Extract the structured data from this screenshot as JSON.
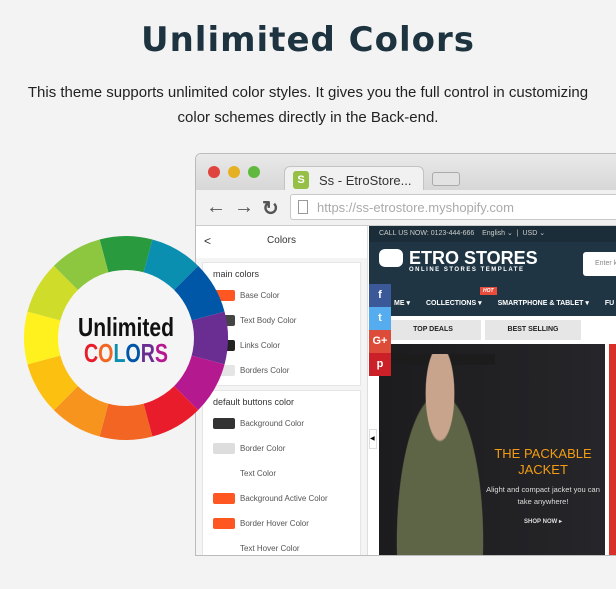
{
  "title": "Unlimited Colors",
  "description": "This theme supports unlimited color styles. It gives you the full control in customizing color schemes directly in the Back-end.",
  "badge": {
    "line1": "Unlimited",
    "line2": [
      "C",
      "O",
      "L",
      "O",
      "R",
      "S"
    ],
    "line2_colors": [
      "#e81c2a",
      "#f26522",
      "#0a8fb0",
      "#0057a8",
      "#6a2d91",
      "#b5198f"
    ],
    "wheel_colors": [
      "#2a9a3e",
      "#0a8fb0",
      "#0057a8",
      "#6a2d91",
      "#b5198f",
      "#e81c2a",
      "#f26522",
      "#f7941d",
      "#fcc010",
      "#fff11e",
      "#cfdc2a",
      "#8dc63f"
    ]
  },
  "browser": {
    "tab": "Ss - EtroStore...",
    "url": "https://ss-etrostore.myshopify.com"
  },
  "sidebar": {
    "back": "<",
    "title": "Colors",
    "main": {
      "heading": "main colors",
      "items": [
        {
          "label": "Base Color",
          "color": "#ff5722"
        },
        {
          "label": "Text Body Color",
          "color": "#444444"
        },
        {
          "label": "Links Color",
          "color": "#222222"
        },
        {
          "label": "Borders Color",
          "color": "#e5e5e5"
        }
      ]
    },
    "buttons": {
      "heading": "default buttons color",
      "items": [
        {
          "label": "Background Color",
          "color": "#333333"
        },
        {
          "label": "Border Color",
          "color": "#dddddd"
        },
        {
          "label": "Text Color",
          "color": "#ffffff"
        },
        {
          "label": "Background Active Color",
          "color": "#ff5722"
        },
        {
          "label": "Border Hover Color",
          "color": "#ff5722"
        },
        {
          "label": "Text Hover Color",
          "color": "#ffffff"
        }
      ]
    }
  },
  "store": {
    "call": "CALL US NOW: 0123-444-666",
    "lang": "English ⌄",
    "currency": "USD ⌄",
    "logo": "ETRO STORES",
    "logo_sub": "ONLINE STORES TEMPLATE",
    "search": "Enter k",
    "menu": [
      "ME ▾",
      "COLLECTIONS ▾",
      "SMARTPHONE & TABLET ▾",
      "FU"
    ],
    "hot": "HOT",
    "tabs": [
      "TOP DEALS",
      "BEST SELLING"
    ],
    "social": [
      "f",
      "t",
      "G+",
      "p"
    ],
    "banner": {
      "title": "THE PACKABLE JACKET",
      "subtitle": "Alight and compact jacket you can take anywhere!",
      "cta": "SHOP NOW ▸"
    }
  }
}
